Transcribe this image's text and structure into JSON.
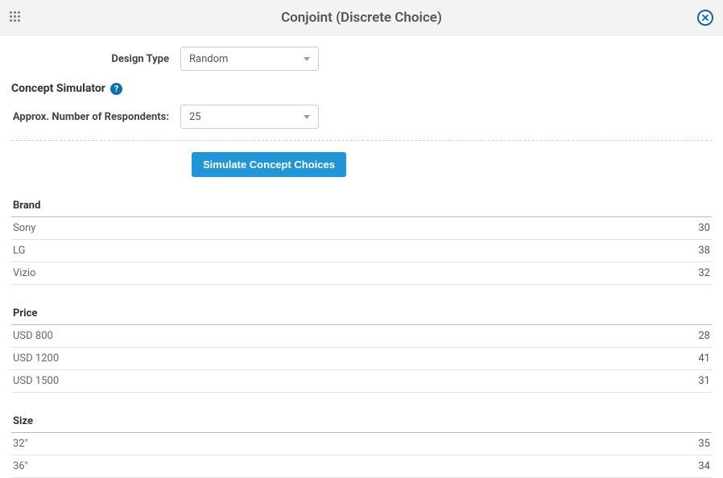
{
  "header": {
    "title": "Conjoint (Discrete Choice)"
  },
  "form": {
    "designType": {
      "label": "Design Type",
      "value": "Random"
    },
    "sectionTitle": "Concept Simulator",
    "respondents": {
      "label": "Approx. Number of Respondents:",
      "value": "25"
    },
    "simulateBtn": "Simulate Concept Choices"
  },
  "results": {
    "groups": [
      {
        "title": "Brand",
        "rows": [
          {
            "label": "Sony",
            "value": "30"
          },
          {
            "label": "LG",
            "value": "38"
          },
          {
            "label": "Vizio",
            "value": "32"
          }
        ]
      },
      {
        "title": "Price",
        "rows": [
          {
            "label": "USD 800",
            "value": "28"
          },
          {
            "label": "USD 1200",
            "value": "41"
          },
          {
            "label": "USD 1500",
            "value": "31"
          }
        ]
      },
      {
        "title": "Size",
        "rows": [
          {
            "label": "32\"",
            "value": "35"
          },
          {
            "label": "36\"",
            "value": "34"
          }
        ]
      }
    ]
  }
}
